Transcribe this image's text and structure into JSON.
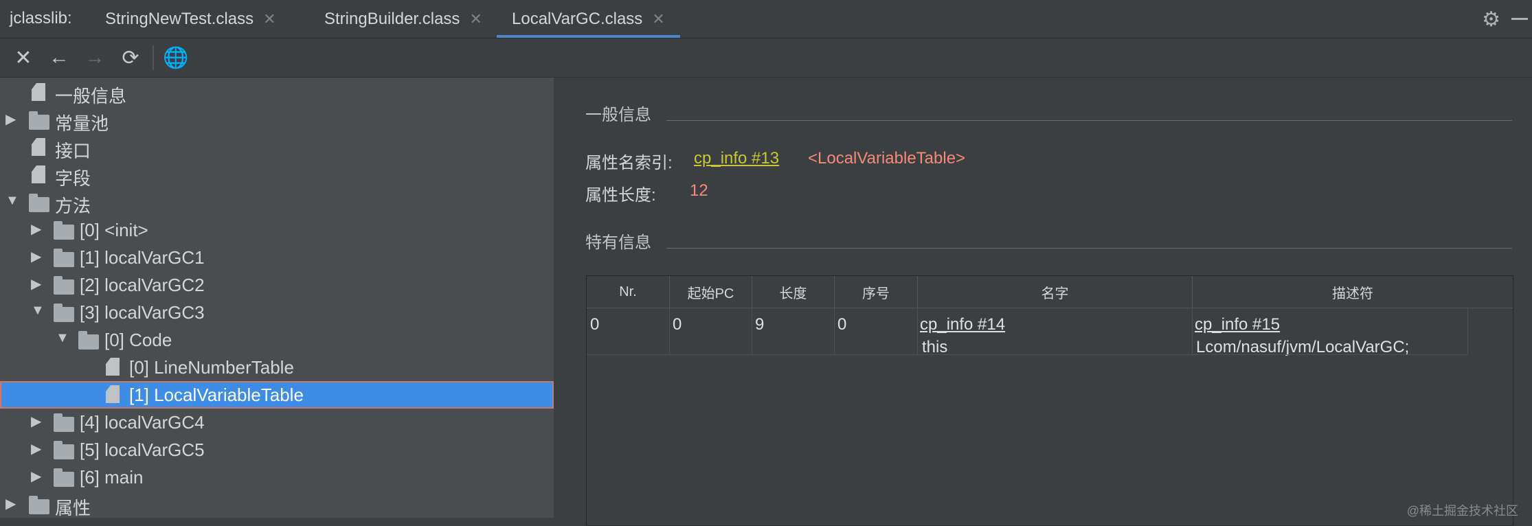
{
  "tabs": {
    "prefix": "jclasslib:",
    "items": [
      {
        "label": "StringNewTest.class"
      },
      {
        "label": "StringBuilder.class"
      },
      {
        "label": "LocalVarGC.class"
      }
    ]
  },
  "tree": {
    "items": [
      {
        "label": "一般信息"
      },
      {
        "label": "常量池"
      },
      {
        "label": "接口"
      },
      {
        "label": "字段"
      },
      {
        "label": "方法"
      },
      {
        "label": "[0] <init>"
      },
      {
        "label": "[1] localVarGC1"
      },
      {
        "label": "[2] localVarGC2"
      },
      {
        "label": "[3] localVarGC3"
      },
      {
        "label": "[0] Code"
      },
      {
        "label": "[0] LineNumberTable"
      },
      {
        "label": "[1] LocalVariableTable"
      },
      {
        "label": "[4] localVarGC4"
      },
      {
        "label": "[5] localVarGC5"
      },
      {
        "label": "[6] main"
      },
      {
        "label": "属性"
      }
    ]
  },
  "general": {
    "title": "一般信息",
    "name_index_label": "属性名索引:",
    "name_index_link": "cp_info #13",
    "name_index_value": "<LocalVariableTable>",
    "length_label": "属性长度:",
    "length_value": "12"
  },
  "specific": {
    "title": "特有信息",
    "headers": [
      "Nr.",
      "起始PC",
      "长度",
      "序号",
      "名字",
      "描述符"
    ],
    "rows": [
      {
        "nr": "0",
        "start_pc": "0",
        "length": "9",
        "index": "0",
        "name_link": "cp_info #14",
        "name_value": "this",
        "desc_link": "cp_info #15",
        "desc_value": "Lcom/nasuf/jvm/LocalVarGC;"
      }
    ]
  },
  "watermark": "@稀土掘金技术社区",
  "colors": {
    "accent": "#4a88c7",
    "selection": "#3d8de6",
    "link": "#c8c930",
    "value": "#f38a7a"
  }
}
